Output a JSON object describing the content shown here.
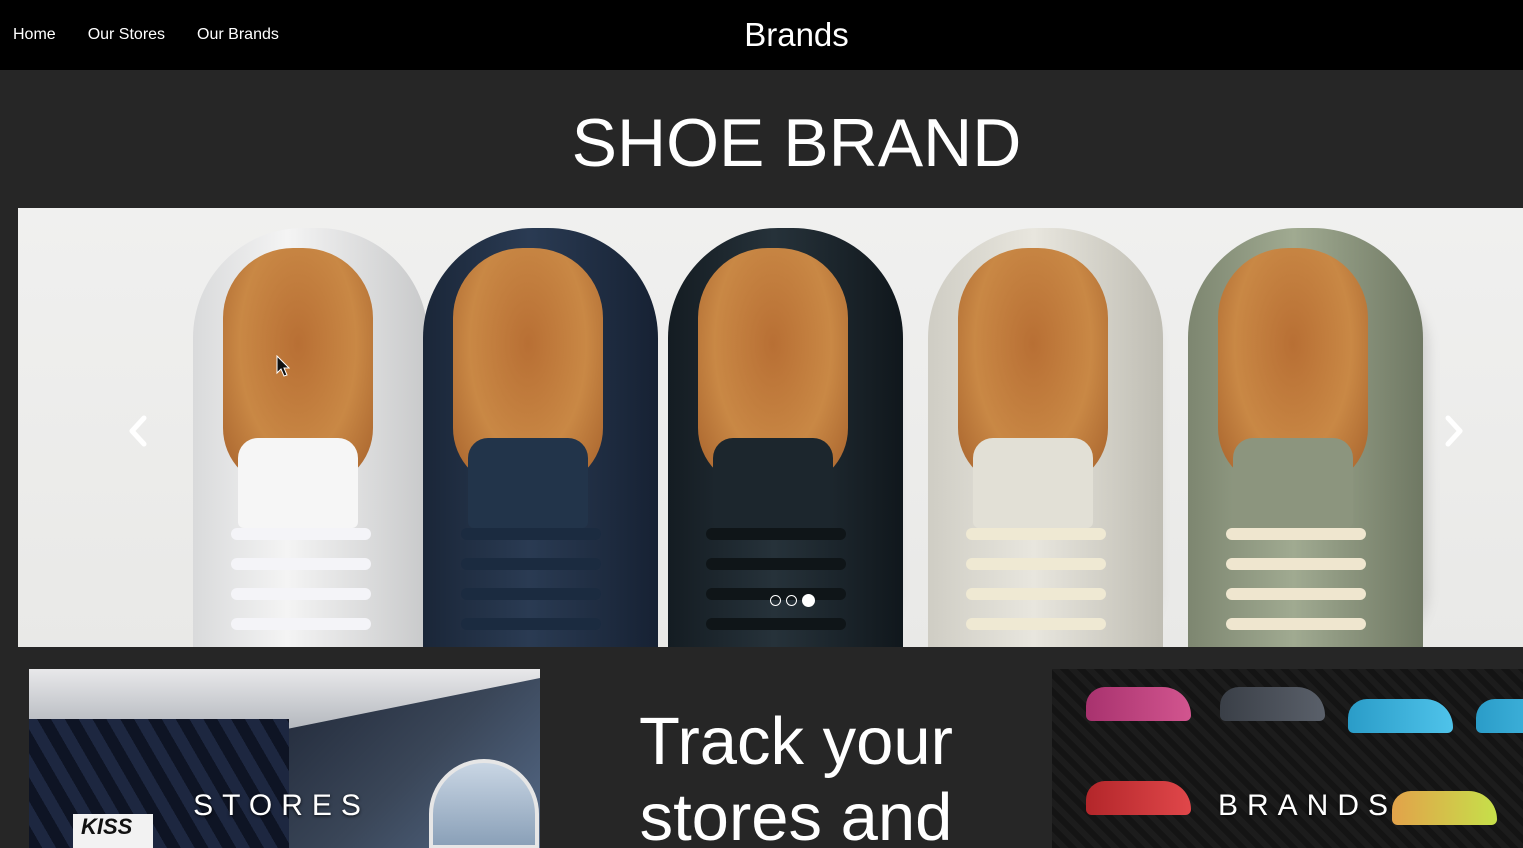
{
  "nav": {
    "items": [
      {
        "label": "Home"
      },
      {
        "label": "Our Stores"
      },
      {
        "label": "Our Brands"
      }
    ],
    "title": "Brands"
  },
  "hero": {
    "title": "SHOE BRAND"
  },
  "carousel": {
    "slide_count": 3,
    "active_slide": 3,
    "prev_icon": "chevron-left-icon",
    "next_icon": "chevron-right-icon"
  },
  "tiles": {
    "stores_label": "STORES",
    "brands_label": "BRANDS",
    "middle_text": "Track your stores and"
  },
  "colors": {
    "topbar": "#000000",
    "background": "#262626",
    "text": "#ffffff"
  }
}
